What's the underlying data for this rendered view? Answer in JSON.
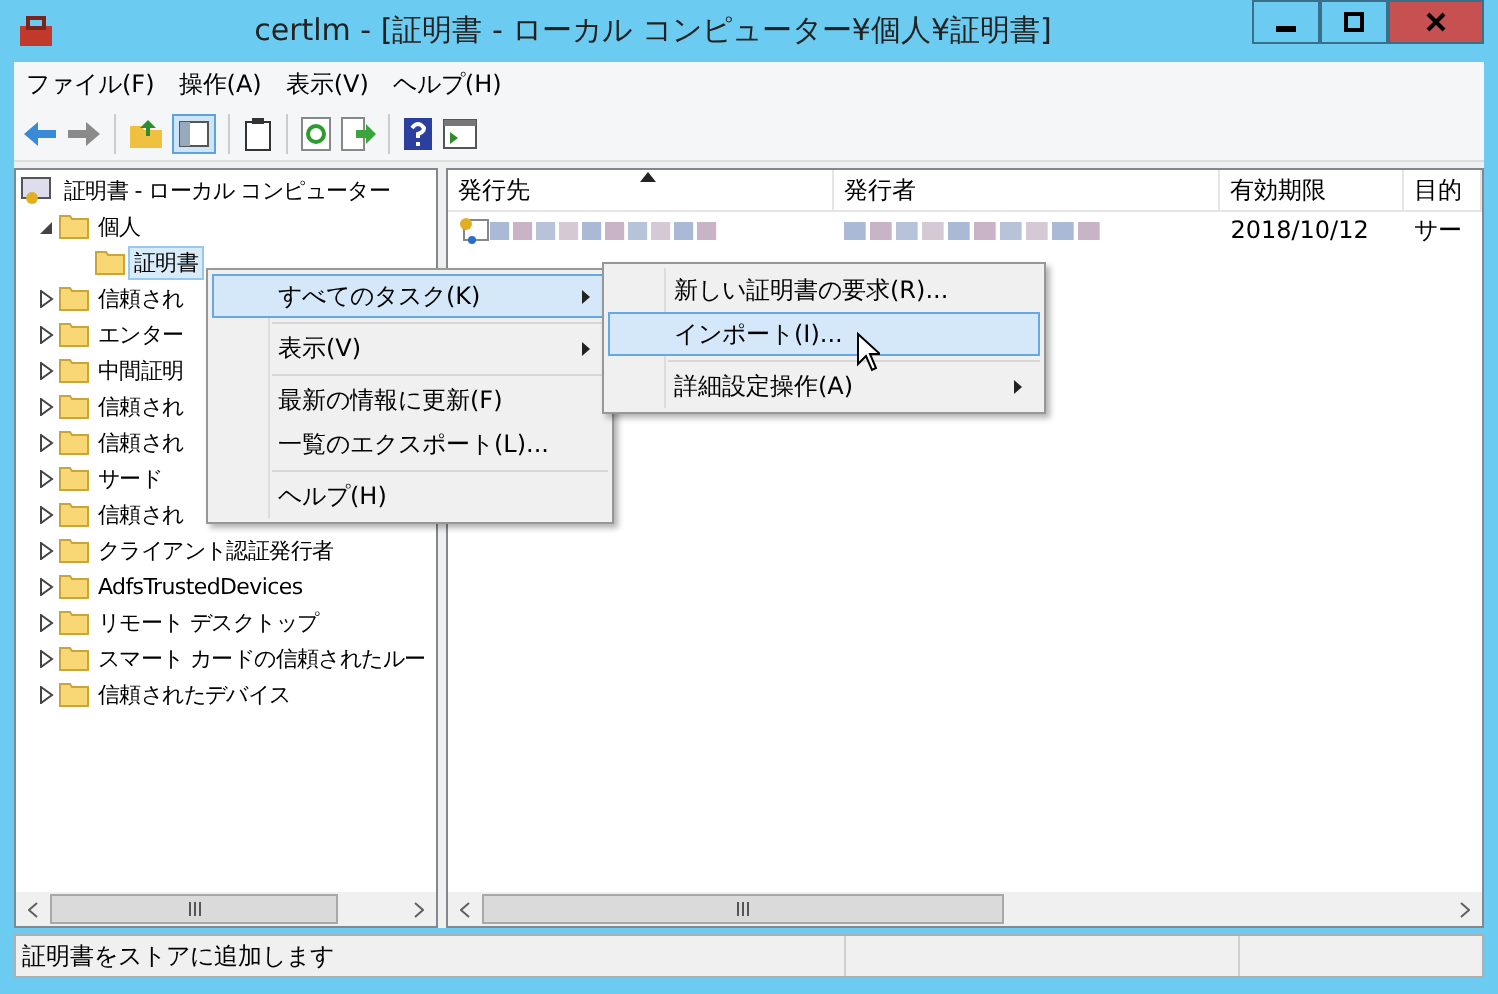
{
  "window": {
    "title": "certlm - [証明書 - ローカル コンピューター¥個人¥証明書]"
  },
  "menu_bar": [
    "ファイル(F)",
    "操作(A)",
    "表示(V)",
    "ヘルプ(H)"
  ],
  "tree": {
    "label": "証明書 - ローカル コンピューター",
    "children": [
      {
        "label": "個人",
        "expanded": true,
        "selected": false,
        "children": [
          {
            "label": "証明書",
            "selected": true
          }
        ]
      },
      {
        "label": "信頼され",
        "expanded": false,
        "selected": false
      },
      {
        "label": "エンター",
        "expanded": false,
        "selected": false
      },
      {
        "label": "中間証明",
        "expanded": false,
        "selected": false
      },
      {
        "label": "信頼され",
        "expanded": false,
        "selected": false
      },
      {
        "label": "信頼され",
        "expanded": false,
        "selected": false
      },
      {
        "label": "サード",
        "expanded": false,
        "selected": false
      },
      {
        "label": "信頼され",
        "expanded": false,
        "selected": false
      },
      {
        "label": "クライアント認証発行者",
        "expanded": false,
        "selected": false
      },
      {
        "label": "AdfsTrustedDevices",
        "expanded": false,
        "selected": false
      },
      {
        "label": "リモート デスクトップ",
        "expanded": false,
        "selected": false
      },
      {
        "label": "スマート カードの信頼されたルー",
        "expanded": false,
        "selected": false
      },
      {
        "label": "信頼されたデバイス",
        "expanded": false,
        "selected": false
      }
    ]
  },
  "list": {
    "columns": [
      {
        "label": "発行先",
        "sorted": true
      },
      {
        "label": "発行者",
        "sorted": false
      },
      {
        "label": "有効期限",
        "sorted": false
      },
      {
        "label": "目的",
        "sorted": false
      }
    ],
    "rows": [
      {
        "cells": [
          {
            "kind": "redacted"
          },
          {
            "kind": "redacted"
          },
          {
            "kind": "text",
            "text": "2018/10/12"
          },
          {
            "kind": "text",
            "text": "サー"
          }
        ]
      }
    ]
  },
  "context_menu": [
    {
      "kind": "item",
      "label": "すべてのタスク(K)",
      "submenu": true,
      "selected": true
    },
    {
      "kind": "separator"
    },
    {
      "kind": "item",
      "label": "表示(V)",
      "submenu": true,
      "selected": false
    },
    {
      "kind": "separator"
    },
    {
      "kind": "item",
      "label": "最新の情報に更新(F)",
      "submenu": false,
      "selected": false
    },
    {
      "kind": "item",
      "label": "一覧のエクスポート(L)...",
      "submenu": false,
      "selected": false
    },
    {
      "kind": "separator"
    },
    {
      "kind": "item",
      "label": "ヘルプ(H)",
      "submenu": false,
      "selected": false
    }
  ],
  "submenu": [
    {
      "kind": "item",
      "label": "新しい証明書の要求(R)...",
      "submenu": false,
      "selected": false
    },
    {
      "kind": "item",
      "label": "インポート(I)...",
      "submenu": false,
      "selected": true
    },
    {
      "kind": "separator"
    },
    {
      "kind": "item",
      "label": "詳細設定操作(A)",
      "submenu": true,
      "selected": false
    }
  ],
  "status_bar": {
    "text": "証明書をストアに追加します"
  }
}
